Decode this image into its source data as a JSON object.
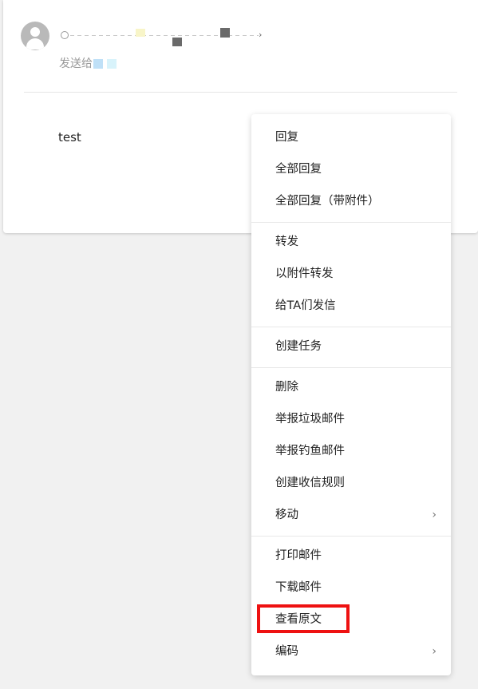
{
  "email": {
    "sent_to_label": "发送给",
    "body_text": "test"
  },
  "context_menu": {
    "reply": "回复",
    "reply_all": "全部回复",
    "reply_all_with_attachments": "全部回复（带附件）",
    "forward": "转发",
    "forward_as_attachment": "以附件转发",
    "send_to_them": "给TA们发信",
    "create_task": "创建任务",
    "delete": "删除",
    "report_spam": "举报垃圾邮件",
    "report_phishing": "举报钓鱼邮件",
    "create_rule": "创建收信规则",
    "move": "移动",
    "print": "打印邮件",
    "download": "下载邮件",
    "view_source": "查看原文",
    "encoding": "编码",
    "submenu_icon": "chevron-right-icon"
  },
  "highlight": {
    "target": "查看原文",
    "color": "#ee1111"
  }
}
